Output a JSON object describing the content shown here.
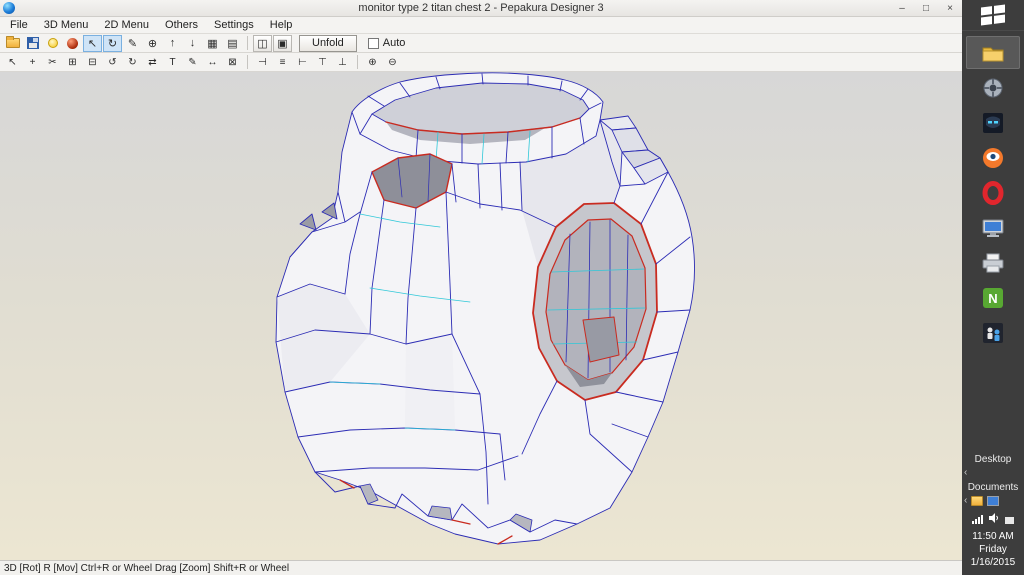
{
  "window": {
    "title": "monitor type 2 titan chest 2 - Pepakura Designer 3",
    "controls": [
      {
        "name": "minimize-button",
        "glyph": "–"
      },
      {
        "name": "maximize-button",
        "glyph": "□"
      },
      {
        "name": "close-button",
        "glyph": "×"
      }
    ]
  },
  "menu": {
    "items": [
      "File",
      "3D Menu",
      "2D Menu",
      "Others",
      "Settings",
      "Help"
    ]
  },
  "toolbar1": {
    "unfold_label": "Unfold",
    "auto_label": "Auto",
    "icons": [
      {
        "name": "open-file-icon"
      },
      {
        "name": "save-file-icon"
      },
      {
        "name": "light-bulb-icon"
      },
      {
        "name": "material-sphere-icon"
      },
      {
        "name": "select-tool-icon",
        "glyph": "↖"
      },
      {
        "name": "rotate-view-icon",
        "glyph": "↻"
      },
      {
        "name": "edit-pencil-icon",
        "glyph": "✎"
      },
      {
        "name": "anchor-icon",
        "glyph": "⊕"
      },
      {
        "name": "flap-up-icon",
        "glyph": "↑"
      },
      {
        "name": "flap-down-icon",
        "glyph": "↓"
      },
      {
        "name": "grid-view-icon",
        "glyph": "▦"
      },
      {
        "name": "list-view-icon",
        "glyph": "▤"
      },
      {
        "name": "layout-both-icon",
        "glyph": "◫"
      },
      {
        "name": "layout-single-icon",
        "glyph": "▣"
      }
    ]
  },
  "toolbar2": {
    "icons": [
      {
        "name": "select-2d-icon",
        "glyph": "↖"
      },
      {
        "name": "move-part-icon",
        "glyph": "+"
      },
      {
        "name": "scissors-icon",
        "glyph": "✂"
      },
      {
        "name": "join-edge-icon",
        "glyph": "⊞"
      },
      {
        "name": "divide-edge-icon",
        "glyph": "⊟"
      },
      {
        "name": "rotate-ccw-icon",
        "glyph": "↺"
      },
      {
        "name": "rotate-cw-icon",
        "glyph": "↻"
      },
      {
        "name": "mirror-icon",
        "glyph": "⇄"
      },
      {
        "name": "text-tool-icon",
        "glyph": "T"
      },
      {
        "name": "draw-tool-icon",
        "glyph": "✎"
      },
      {
        "name": "measure-icon",
        "glyph": "↔"
      },
      {
        "name": "overlap-check-icon",
        "glyph": "⊠"
      },
      {
        "name": "align-left-icon",
        "glyph": "⊣"
      },
      {
        "name": "align-center-icon",
        "glyph": "≡"
      },
      {
        "name": "align-right-icon",
        "glyph": "⊢"
      },
      {
        "name": "align-top-icon",
        "glyph": "⊤"
      },
      {
        "name": "align-bottom-icon",
        "glyph": "⊥"
      },
      {
        "name": "zoom-in-icon",
        "glyph": "⊕"
      },
      {
        "name": "zoom-out-icon",
        "glyph": "⊖"
      }
    ]
  },
  "viewport": {
    "background_top": "#d7d7d7",
    "background_bottom": "#ece6d2",
    "edge_color": "#2c2cb4",
    "cut_color": "#c92b20",
    "fold_color": "#2fc8d8"
  },
  "statusbar": {
    "text": "3D [Rot] R [Mov] Ctrl+R or Wheel Drag [Zoom] Shift+R or Wheel"
  },
  "taskbar": {
    "desktop_label": "Desktop",
    "documents_label": "Documents",
    "chevron_glyph": "‹",
    "clock": {
      "time": "11:50 AM",
      "day": "Friday",
      "date": "1/16/2015"
    },
    "apps": [
      {
        "name": "file-explorer-icon"
      },
      {
        "name": "wheel-app-icon"
      },
      {
        "name": "mask-game-icon"
      },
      {
        "name": "blender-icon"
      },
      {
        "name": "opera-icon"
      },
      {
        "name": "computer-icon"
      },
      {
        "name": "printer-icon"
      },
      {
        "name": "green-app-icon",
        "letter": "N"
      },
      {
        "name": "figures-game-icon"
      }
    ]
  }
}
